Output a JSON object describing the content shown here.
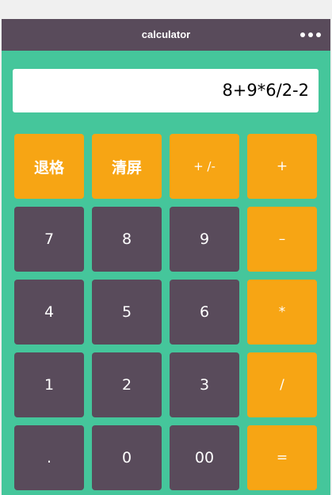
{
  "header": {
    "title": "calculator",
    "more_icon": "more-dots-icon"
  },
  "display": {
    "expression": "8+9*6/2-2"
  },
  "keys": {
    "backspace": "退格",
    "clear": "清屏",
    "negate": "+ /-",
    "plus": "+",
    "seven": "7",
    "eight": "8",
    "nine": "9",
    "minus": "–",
    "four": "4",
    "five": "5",
    "six": "6",
    "multiply": "*",
    "one": "1",
    "two": "2",
    "three": "3",
    "divide": "/",
    "dot": ".",
    "zero": "0",
    "double_zero": "00",
    "equals": "="
  },
  "colors": {
    "background": "#45c69b",
    "dark_key": "#594b5b",
    "operator_key": "#f7a514",
    "display_bg": "#ffffff"
  }
}
